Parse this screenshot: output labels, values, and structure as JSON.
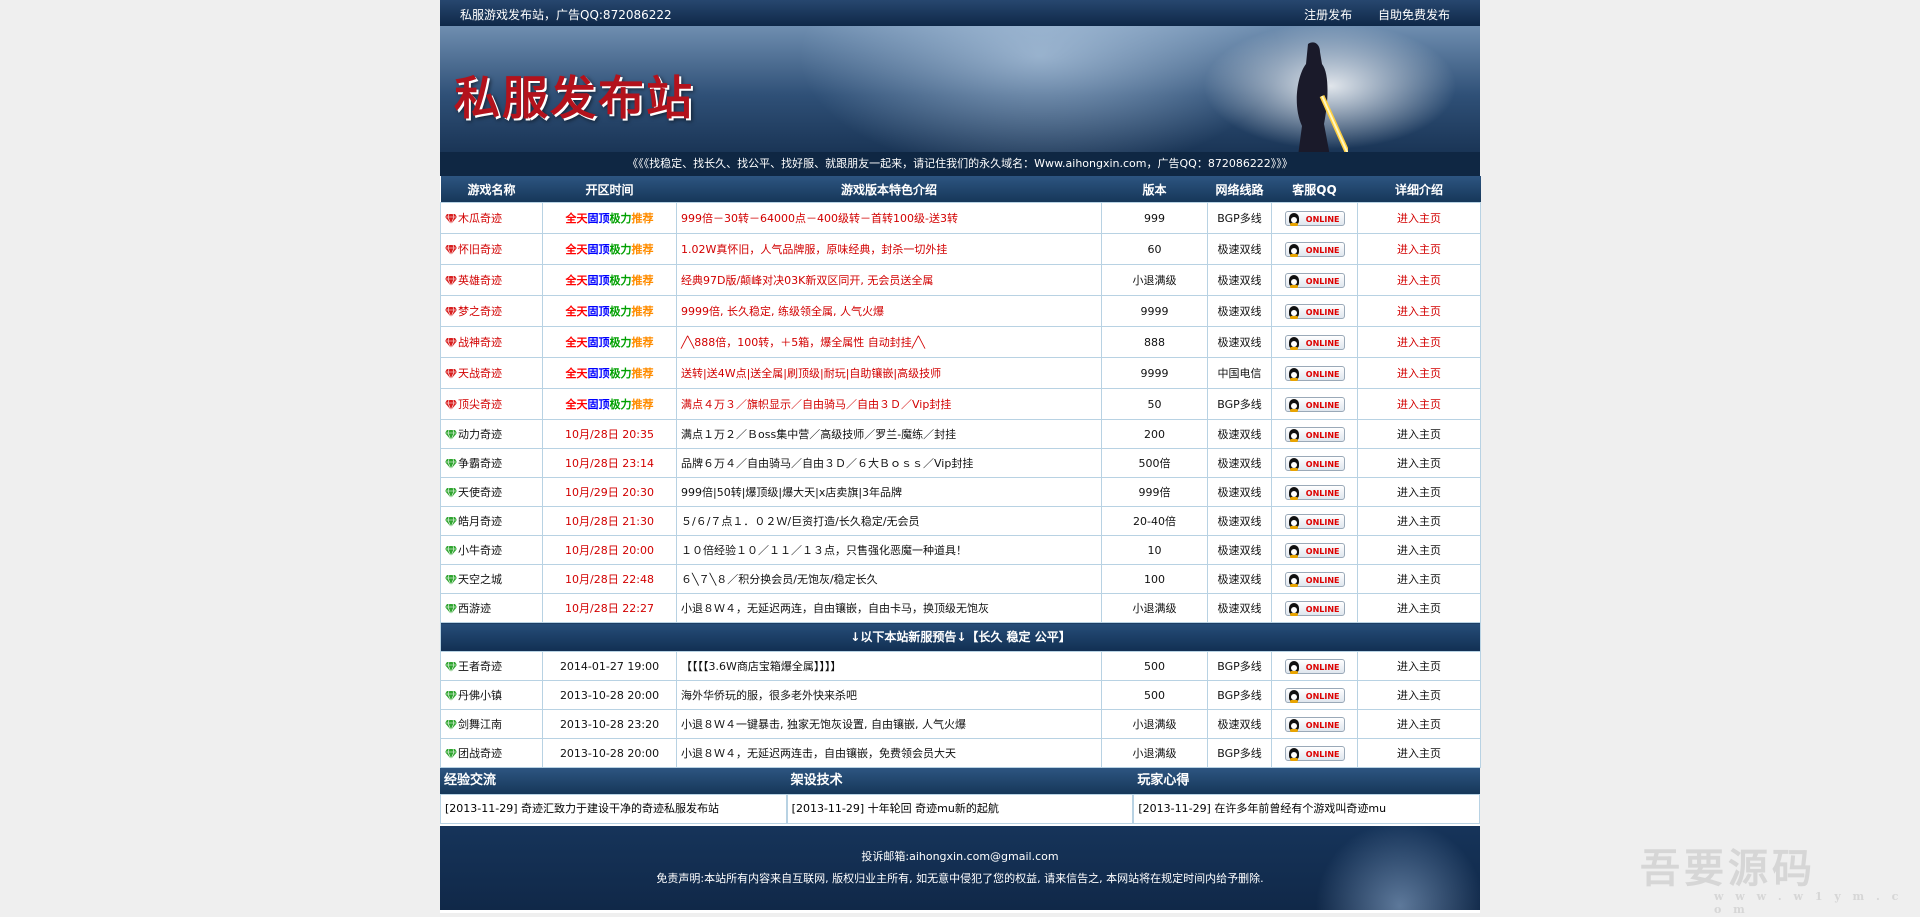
{
  "header": {
    "site_info": "私服游戏发布站，广告QQ:872086222",
    "links": [
      "注册发布",
      "自助免费发布"
    ],
    "banner_title": "私服发布站",
    "notice": "《《《找稳定、找长久、找公平、找好服、就跟朋友一起来，请记住我们的永久域名：Www.aihongxin.com，广告QQ：872086222》》》"
  },
  "table": {
    "columns": [
      "游戏名称",
      "开区时间",
      "游戏版本特色介绍",
      "版本",
      "网络线路",
      "客服QQ",
      "详细介绍"
    ],
    "qq_label": "ONLINE",
    "link_label": "进入主页",
    "featured_time_parts": [
      "全天",
      "固顶",
      "极力",
      "推荐"
    ],
    "featured": [
      {
        "name": "木瓜奇迹",
        "desc": "999倍－30转－64000点－400级转－首转100级-送3转",
        "version": "999",
        "line": "BGP多线"
      },
      {
        "name": "怀旧奇迹",
        "desc": "1.02W真怀旧，人气品牌服，原味经典，封杀一切外挂",
        "version": "60",
        "line": "极速双线"
      },
      {
        "name": "英雄奇迹",
        "desc": "经典97D版/颠峰对决03K新双区同开, 无会员送全属",
        "version": "小退满级",
        "line": "极速双线"
      },
      {
        "name": "梦之奇迹",
        "desc": "9999倍, 长久稳定, 练级领全属, 人气火爆",
        "version": "9999",
        "line": "极速双线"
      },
      {
        "name": "战神奇迹",
        "desc": "╱╲888倍，100转，＋5箱，爆全属性 自动封挂╱╲",
        "version": "888",
        "line": "极速双线"
      },
      {
        "name": "天战奇迹",
        "desc": "送转|送4W点|送全属|刷顶级|耐玩|自助镶嵌|高级技师",
        "version": "9999",
        "line": "中国电信"
      },
      {
        "name": "顶尖奇迹",
        "desc": "满点４万３／旗帜显示／自由骑马／自由３Ｄ／Vip封挂",
        "version": "50",
        "line": "BGP多线"
      }
    ],
    "normal": [
      {
        "name": "动力奇迹",
        "time": "10月/28日 20:35",
        "desc": "满点１万２／Ｂoss集中营／高级技师／罗兰-魔练／封挂",
        "version": "200",
        "line": "极速双线"
      },
      {
        "name": "争霸奇迹",
        "time": "10月/28日 23:14",
        "desc": "品牌６万４／自由骑马／自由３Ｄ／６大Ｂｏｓｓ／Vip封挂",
        "version": "500倍",
        "line": "极速双线"
      },
      {
        "name": "天使奇迹",
        "time": "10月/29日 20:30",
        "desc": "999倍|50转|爆顶级|爆大天|x店卖旗|3年品牌",
        "version": "999倍",
        "line": "极速双线"
      },
      {
        "name": "皓月奇迹",
        "time": "10月/28日 21:30",
        "desc": "５/６/７点１．０２Ｗ/巨资打造/长久稳定/无会员",
        "version": "20-40倍",
        "line": "极速双线"
      },
      {
        "name": "小牛奇迹",
        "time": "10月/28日 20:00",
        "desc": "１０倍经验１０／１１／１３点，只售强化恶魔一种道具！",
        "version": "10",
        "line": "极速双线"
      },
      {
        "name": "天空之城",
        "time": "10月/28日 22:48",
        "desc": "６╲７╲８／积分换会员/无饱灰/稳定长久",
        "version": "100",
        "line": "极速双线"
      },
      {
        "name": "西游迹",
        "time": "10月/28日 22:27",
        "desc": "小退８Ｗ４，无延迟两连，自由镶嵌，自由卡马，换顶级无饱灰",
        "version": "小退满级",
        "line": "极速双线"
      }
    ],
    "separator": "↓以下本站新服预告↓【长久 稳定 公平】",
    "upcoming": [
      {
        "name": "王者奇迹",
        "time": "2014-01-27 19:00",
        "desc": "【【【【3.6W商店宝箱爆全属】】】】",
        "version": "500",
        "line": "BGP多线"
      },
      {
        "name": "丹佛小镇",
        "time": "2013-10-28 20:00",
        "desc": "海外华侨玩的服，很多老外快来杀吧",
        "version": "500",
        "line": "BGP多线"
      },
      {
        "name": "剑舞江南",
        "time": "2013-10-28 23:20",
        "desc": "小退８Ｗ４一键暴击, 独家无饱灰设置, 自由镶嵌, 人气火爆",
        "version": "小退满级",
        "line": "极速双线"
      },
      {
        "name": "团战奇迹",
        "time": "2013-10-28 20:00",
        "desc": "小退８Ｗ４，无延迟两连击，自由镶嵌，免费领会员大天",
        "version": "小退满级",
        "line": "BGP多线"
      }
    ]
  },
  "sections": [
    {
      "title": "经验交流",
      "item": "[2013-11-29]  奇迹汇致力于建设干净的奇迹私服发布站"
    },
    {
      "title": "架设技术",
      "item": "[2013-11-29]  十年轮回 奇迹mu新的起航"
    },
    {
      "title": "玩家心得",
      "item": "[2013-11-29]  在许多年前曾经有个游戏叫奇迹mu"
    }
  ],
  "footer": {
    "email": "投诉邮箱:aihongxin.com@gmail.com",
    "disclaimer": "免责声明:本站所有内容来自互联网, 版权归业主所有, 如无意中侵犯了您的权益, 请来信告之, 本网站将在规定时间内给予删除."
  },
  "watermark": {
    "text": "吾要源码",
    "url": "w w w . w 1 y m . c o m"
  },
  "colors": {
    "red": "#d20000",
    "header_blue": "#163759",
    "featured_gem": "#d81f1f",
    "normal_gem": "#2fa52f"
  }
}
